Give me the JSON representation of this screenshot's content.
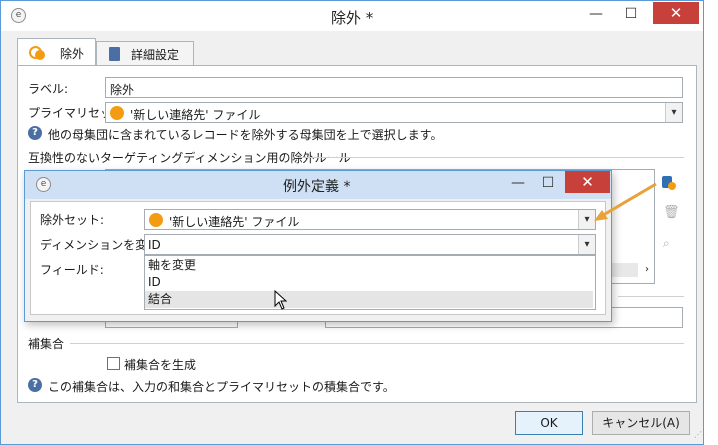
{
  "window": {
    "title": "除外 *",
    "minimize": "—",
    "maximize": "☐",
    "close": "✕"
  },
  "tabs": [
    {
      "label": "除外"
    },
    {
      "label": "詳細設定"
    }
  ],
  "form": {
    "label_caption": "ラベル:",
    "label_value": "除外",
    "primary_set_caption": "プライマリセット:",
    "primary_set_value": "'新しい連絡先' ファイル",
    "help_text_1": "他の母集団に含まれているレコードを除外する母集団を上で選択します。",
    "exclusion_rules_heading": "互換性のないターゲティングディメンション用の除外ルール"
  },
  "complement": {
    "heading": "補集合",
    "checkbox_label": "補集合を生成",
    "checked": false,
    "help_text": "この補集合は、入力の和集合とプライマリセットの積集合です。"
  },
  "footer": {
    "ok_label": "OK",
    "cancel_label": "キャンセル(A)"
  },
  "dialog": {
    "title": "例外定義 *",
    "minimize": "—",
    "maximize": "☐",
    "close": "✕",
    "exclusion_set_caption": "除外セット:",
    "exclusion_set_value": "'新しい連絡先' ファイル",
    "change_dimension_caption": "ディメンションを変更:",
    "change_dimension_value": "ID",
    "field_caption": "フィールド:",
    "options": [
      "軸を変更",
      "ID",
      "結合"
    ],
    "highlighted_option": "結合"
  },
  "colors": {
    "accent_blue": "#5b9bd5",
    "close_red": "#c8403a",
    "orange": "#f39c12",
    "arrow": "#e8a23a"
  }
}
